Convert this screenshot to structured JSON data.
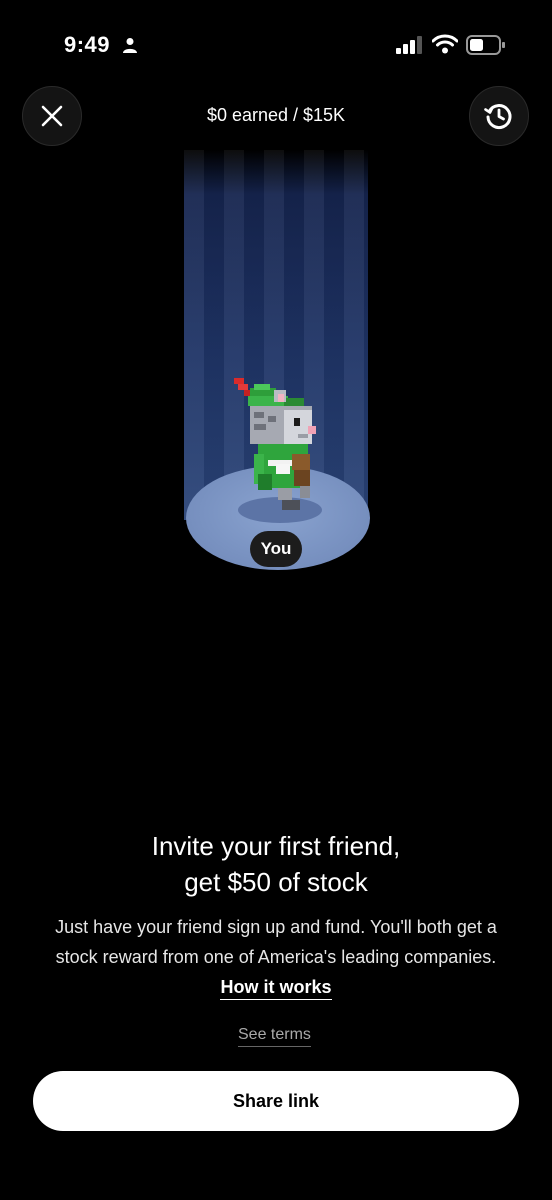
{
  "status_bar": {
    "time": "9:49",
    "icons": [
      "person-icon",
      "signal-icon",
      "wifi-icon",
      "battery-icon"
    ]
  },
  "header": {
    "earned_text": "$0 earned / $15K",
    "close_icon": "close-icon",
    "history_icon": "history-icon"
  },
  "scene": {
    "avatar_label": "You"
  },
  "content": {
    "headline_line1": "Invite your first friend,",
    "headline_line2": "get $50 of stock",
    "body": "Just have your friend sign up and fund. You'll both get a stock reward from one of America's leading companies.",
    "how_it_works": "How it works",
    "see_terms": "See terms"
  },
  "actions": {
    "share_label": "Share link"
  },
  "colors": {
    "background": "#000000",
    "beam": "#1f3466",
    "platform": "#7a93c2",
    "button_bg": "#ffffff"
  }
}
